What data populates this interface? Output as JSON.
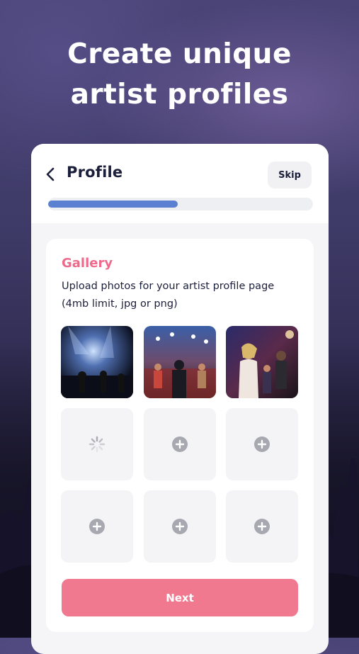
{
  "headline": {
    "line1": "Create unique",
    "line2": "artist profiles"
  },
  "header": {
    "back_icon": "chevron-left-icon",
    "title": "Profile",
    "skip_label": "Skip",
    "progress": 0.49
  },
  "gallery": {
    "title": "Gallery",
    "description": "Upload photos for your artist profile page (4mb limit, jpg or png)",
    "tiles": [
      {
        "state": "photo",
        "content": "concert-stage-photo"
      },
      {
        "state": "photo",
        "content": "band-performance-photo"
      },
      {
        "state": "photo",
        "content": "singer-performance-photo"
      },
      {
        "state": "loading",
        "icon": "spinner-icon"
      },
      {
        "state": "empty",
        "icon": "add-circle-icon"
      },
      {
        "state": "empty",
        "icon": "add-circle-icon"
      },
      {
        "state": "empty",
        "icon": "add-circle-icon"
      },
      {
        "state": "empty",
        "icon": "add-circle-icon"
      },
      {
        "state": "empty",
        "icon": "add-circle-icon"
      }
    ]
  },
  "footer": {
    "next_label": "Next"
  },
  "colors": {
    "accent_pink": "#ee6a8c",
    "button_pink": "#f0788f",
    "progress_blue": "#5b7fd1",
    "text_dark": "#1c1f3a"
  }
}
